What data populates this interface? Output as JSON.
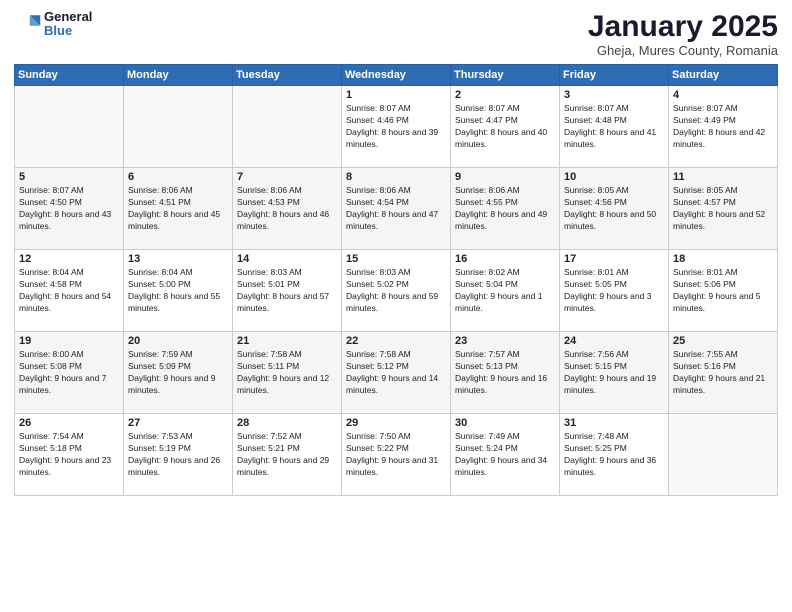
{
  "logo": {
    "general": "General",
    "blue": "Blue"
  },
  "title": {
    "month": "January 2025",
    "location": "Gheja, Mures County, Romania"
  },
  "weekdays": [
    "Sunday",
    "Monday",
    "Tuesday",
    "Wednesday",
    "Thursday",
    "Friday",
    "Saturday"
  ],
  "weeks": [
    [
      {
        "day": "",
        "sunrise": "",
        "sunset": "",
        "daylight": ""
      },
      {
        "day": "",
        "sunrise": "",
        "sunset": "",
        "daylight": ""
      },
      {
        "day": "",
        "sunrise": "",
        "sunset": "",
        "daylight": ""
      },
      {
        "day": "1",
        "sunrise": "Sunrise: 8:07 AM",
        "sunset": "Sunset: 4:46 PM",
        "daylight": "Daylight: 8 hours and 39 minutes."
      },
      {
        "day": "2",
        "sunrise": "Sunrise: 8:07 AM",
        "sunset": "Sunset: 4:47 PM",
        "daylight": "Daylight: 8 hours and 40 minutes."
      },
      {
        "day": "3",
        "sunrise": "Sunrise: 8:07 AM",
        "sunset": "Sunset: 4:48 PM",
        "daylight": "Daylight: 8 hours and 41 minutes."
      },
      {
        "day": "4",
        "sunrise": "Sunrise: 8:07 AM",
        "sunset": "Sunset: 4:49 PM",
        "daylight": "Daylight: 8 hours and 42 minutes."
      }
    ],
    [
      {
        "day": "5",
        "sunrise": "Sunrise: 8:07 AM",
        "sunset": "Sunset: 4:50 PM",
        "daylight": "Daylight: 8 hours and 43 minutes."
      },
      {
        "day": "6",
        "sunrise": "Sunrise: 8:06 AM",
        "sunset": "Sunset: 4:51 PM",
        "daylight": "Daylight: 8 hours and 45 minutes."
      },
      {
        "day": "7",
        "sunrise": "Sunrise: 8:06 AM",
        "sunset": "Sunset: 4:53 PM",
        "daylight": "Daylight: 8 hours and 46 minutes."
      },
      {
        "day": "8",
        "sunrise": "Sunrise: 8:06 AM",
        "sunset": "Sunset: 4:54 PM",
        "daylight": "Daylight: 8 hours and 47 minutes."
      },
      {
        "day": "9",
        "sunrise": "Sunrise: 8:06 AM",
        "sunset": "Sunset: 4:55 PM",
        "daylight": "Daylight: 8 hours and 49 minutes."
      },
      {
        "day": "10",
        "sunrise": "Sunrise: 8:05 AM",
        "sunset": "Sunset: 4:56 PM",
        "daylight": "Daylight: 8 hours and 50 minutes."
      },
      {
        "day": "11",
        "sunrise": "Sunrise: 8:05 AM",
        "sunset": "Sunset: 4:57 PM",
        "daylight": "Daylight: 8 hours and 52 minutes."
      }
    ],
    [
      {
        "day": "12",
        "sunrise": "Sunrise: 8:04 AM",
        "sunset": "Sunset: 4:58 PM",
        "daylight": "Daylight: 8 hours and 54 minutes."
      },
      {
        "day": "13",
        "sunrise": "Sunrise: 8:04 AM",
        "sunset": "Sunset: 5:00 PM",
        "daylight": "Daylight: 8 hours and 55 minutes."
      },
      {
        "day": "14",
        "sunrise": "Sunrise: 8:03 AM",
        "sunset": "Sunset: 5:01 PM",
        "daylight": "Daylight: 8 hours and 57 minutes."
      },
      {
        "day": "15",
        "sunrise": "Sunrise: 8:03 AM",
        "sunset": "Sunset: 5:02 PM",
        "daylight": "Daylight: 8 hours and 59 minutes."
      },
      {
        "day": "16",
        "sunrise": "Sunrise: 8:02 AM",
        "sunset": "Sunset: 5:04 PM",
        "daylight": "Daylight: 9 hours and 1 minute."
      },
      {
        "day": "17",
        "sunrise": "Sunrise: 8:01 AM",
        "sunset": "Sunset: 5:05 PM",
        "daylight": "Daylight: 9 hours and 3 minutes."
      },
      {
        "day": "18",
        "sunrise": "Sunrise: 8:01 AM",
        "sunset": "Sunset: 5:06 PM",
        "daylight": "Daylight: 9 hours and 5 minutes."
      }
    ],
    [
      {
        "day": "19",
        "sunrise": "Sunrise: 8:00 AM",
        "sunset": "Sunset: 5:08 PM",
        "daylight": "Daylight: 9 hours and 7 minutes."
      },
      {
        "day": "20",
        "sunrise": "Sunrise: 7:59 AM",
        "sunset": "Sunset: 5:09 PM",
        "daylight": "Daylight: 9 hours and 9 minutes."
      },
      {
        "day": "21",
        "sunrise": "Sunrise: 7:58 AM",
        "sunset": "Sunset: 5:11 PM",
        "daylight": "Daylight: 9 hours and 12 minutes."
      },
      {
        "day": "22",
        "sunrise": "Sunrise: 7:58 AM",
        "sunset": "Sunset: 5:12 PM",
        "daylight": "Daylight: 9 hours and 14 minutes."
      },
      {
        "day": "23",
        "sunrise": "Sunrise: 7:57 AM",
        "sunset": "Sunset: 5:13 PM",
        "daylight": "Daylight: 9 hours and 16 minutes."
      },
      {
        "day": "24",
        "sunrise": "Sunrise: 7:56 AM",
        "sunset": "Sunset: 5:15 PM",
        "daylight": "Daylight: 9 hours and 19 minutes."
      },
      {
        "day": "25",
        "sunrise": "Sunrise: 7:55 AM",
        "sunset": "Sunset: 5:16 PM",
        "daylight": "Daylight: 9 hours and 21 minutes."
      }
    ],
    [
      {
        "day": "26",
        "sunrise": "Sunrise: 7:54 AM",
        "sunset": "Sunset: 5:18 PM",
        "daylight": "Daylight: 9 hours and 23 minutes."
      },
      {
        "day": "27",
        "sunrise": "Sunrise: 7:53 AM",
        "sunset": "Sunset: 5:19 PM",
        "daylight": "Daylight: 9 hours and 26 minutes."
      },
      {
        "day": "28",
        "sunrise": "Sunrise: 7:52 AM",
        "sunset": "Sunset: 5:21 PM",
        "daylight": "Daylight: 9 hours and 29 minutes."
      },
      {
        "day": "29",
        "sunrise": "Sunrise: 7:50 AM",
        "sunset": "Sunset: 5:22 PM",
        "daylight": "Daylight: 9 hours and 31 minutes."
      },
      {
        "day": "30",
        "sunrise": "Sunrise: 7:49 AM",
        "sunset": "Sunset: 5:24 PM",
        "daylight": "Daylight: 9 hours and 34 minutes."
      },
      {
        "day": "31",
        "sunrise": "Sunrise: 7:48 AM",
        "sunset": "Sunset: 5:25 PM",
        "daylight": "Daylight: 9 hours and 36 minutes."
      },
      {
        "day": "",
        "sunrise": "",
        "sunset": "",
        "daylight": ""
      }
    ]
  ]
}
